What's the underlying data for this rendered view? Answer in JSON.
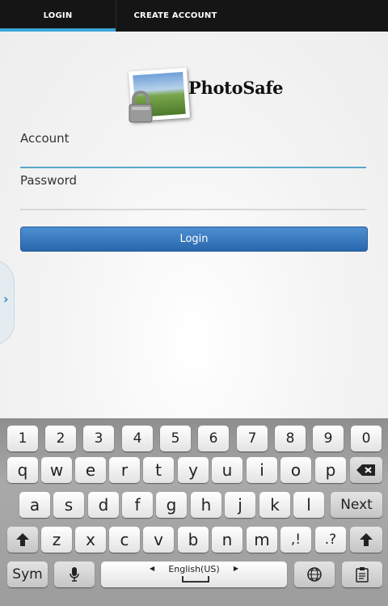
{
  "tabs": {
    "login": "LOGIN",
    "create_account": "CREATE ACCOUNT"
  },
  "logo": {
    "text": "PhotoSafe"
  },
  "form": {
    "account_label": "Account",
    "password_label": "Password",
    "login_button": "Login"
  },
  "keyboard": {
    "row1": [
      "1",
      "2",
      "3",
      "4",
      "5",
      "6",
      "7",
      "8",
      "9",
      "0"
    ],
    "row2": [
      "q",
      "w",
      "e",
      "r",
      "t",
      "y",
      "u",
      "i",
      "o",
      "p"
    ],
    "row3": [
      "a",
      "s",
      "d",
      "f",
      "g",
      "h",
      "j",
      "k",
      "l"
    ],
    "next": "Next",
    "row4": [
      "z",
      "x",
      "c",
      "v",
      "b",
      "n",
      "m"
    ],
    "comma_key": ",!",
    "period_key": ".?",
    "sym": "Sym",
    "space_label": "English(US)"
  },
  "colors": {
    "tab_indicator": "#3aa6d8",
    "button": "#3a7ac0",
    "field_focus": "#5aa7c9"
  }
}
